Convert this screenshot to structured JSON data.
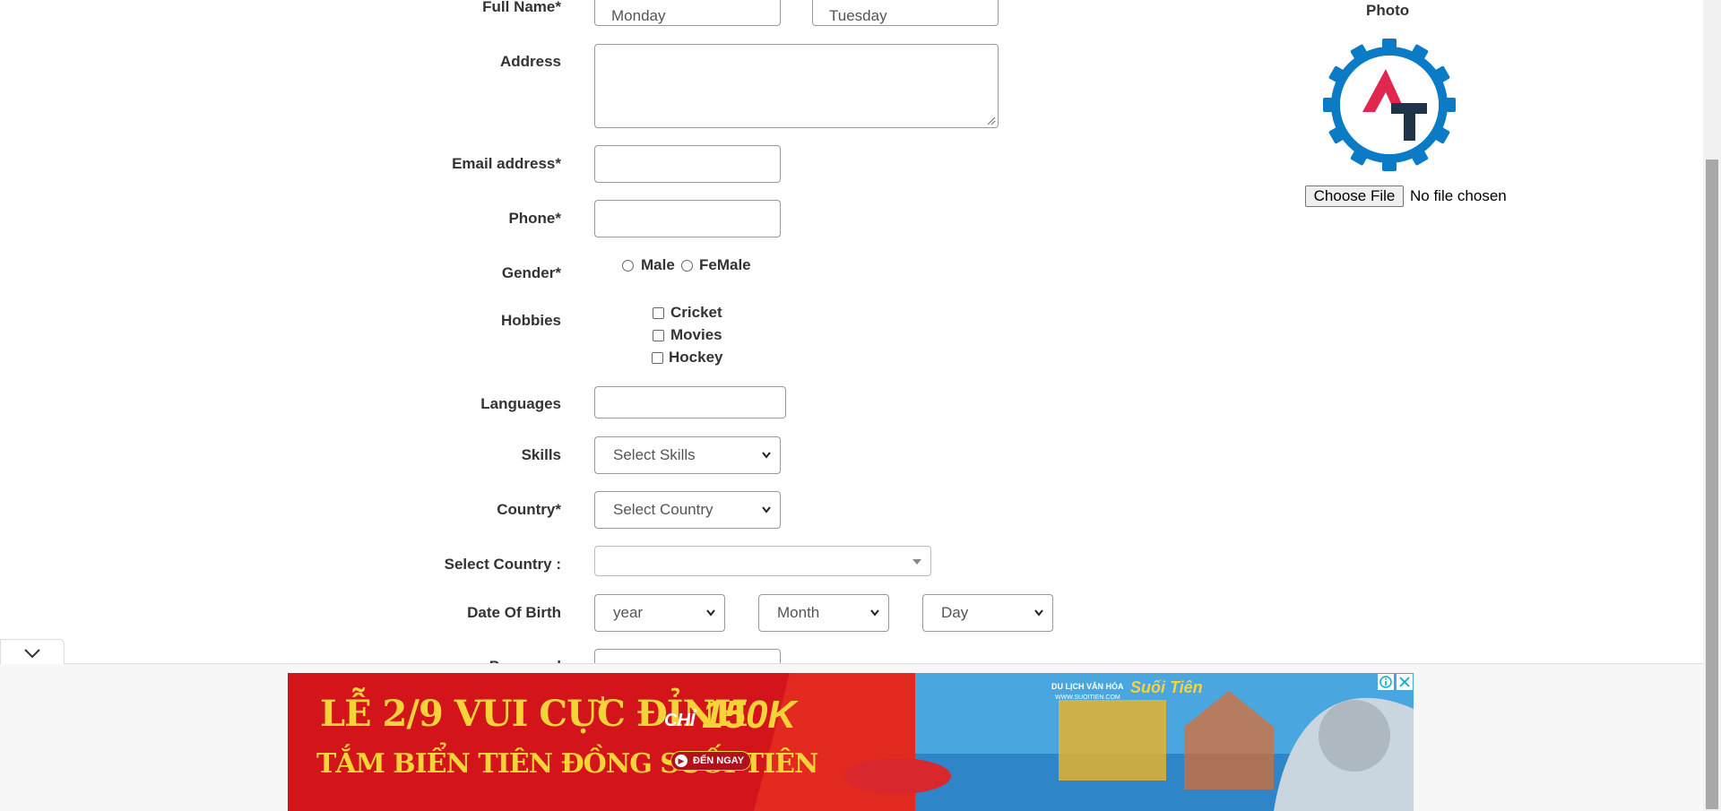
{
  "form": {
    "full_name_label": "Full Name*",
    "first_name_value": "Monday",
    "last_name_value": "Tuesday",
    "address_label": "Address",
    "email_label": "Email address*",
    "phone_label": "Phone*",
    "gender_label": "Gender*",
    "gender_options": [
      "Male",
      "FeMale"
    ],
    "hobbies_label": "Hobbies",
    "hobbies": [
      "Cricket",
      "Movies",
      "Hockey"
    ],
    "languages_label": "Languages",
    "skills_label": "Skills",
    "skills_selected": "Select Skills",
    "country_label": "Country*",
    "country_selected": "Select Country",
    "select_country_label": "Select Country :",
    "dob_label": "Date Of Birth",
    "dob_year": "year",
    "dob_month": "Month",
    "dob_day": "Day",
    "password_label": "Password"
  },
  "photo": {
    "label": "Photo",
    "choose_file_button": "Choose File",
    "file_status": "No file chosen"
  },
  "ad": {
    "headline_1": "LỄ 2/9 VUI CỰC ĐỈNH",
    "price_prefix": "CHỈ",
    "price": "150K",
    "headline_2": "TẮM BIỂN TIÊN ĐỒNG SUỐI TIÊN",
    "cta": "ĐẾN NGAY",
    "brand_small": "DU LỊCH VĂN HÓA",
    "brand_name": "Suối Tiên",
    "brand_url": "WWW.SUOITIEN.COM",
    "colors": {
      "red": "#d3151b",
      "yellow": "#f7d33a",
      "water": "#4aa6df"
    }
  },
  "icons": [
    "chevron-down-icon",
    "info-icon",
    "close-icon",
    "gear-logo-icon"
  ],
  "colors": {
    "logo_blue": "#0a7bc4",
    "logo_red": "#e0284f",
    "logo_dark": "#1f3349"
  }
}
